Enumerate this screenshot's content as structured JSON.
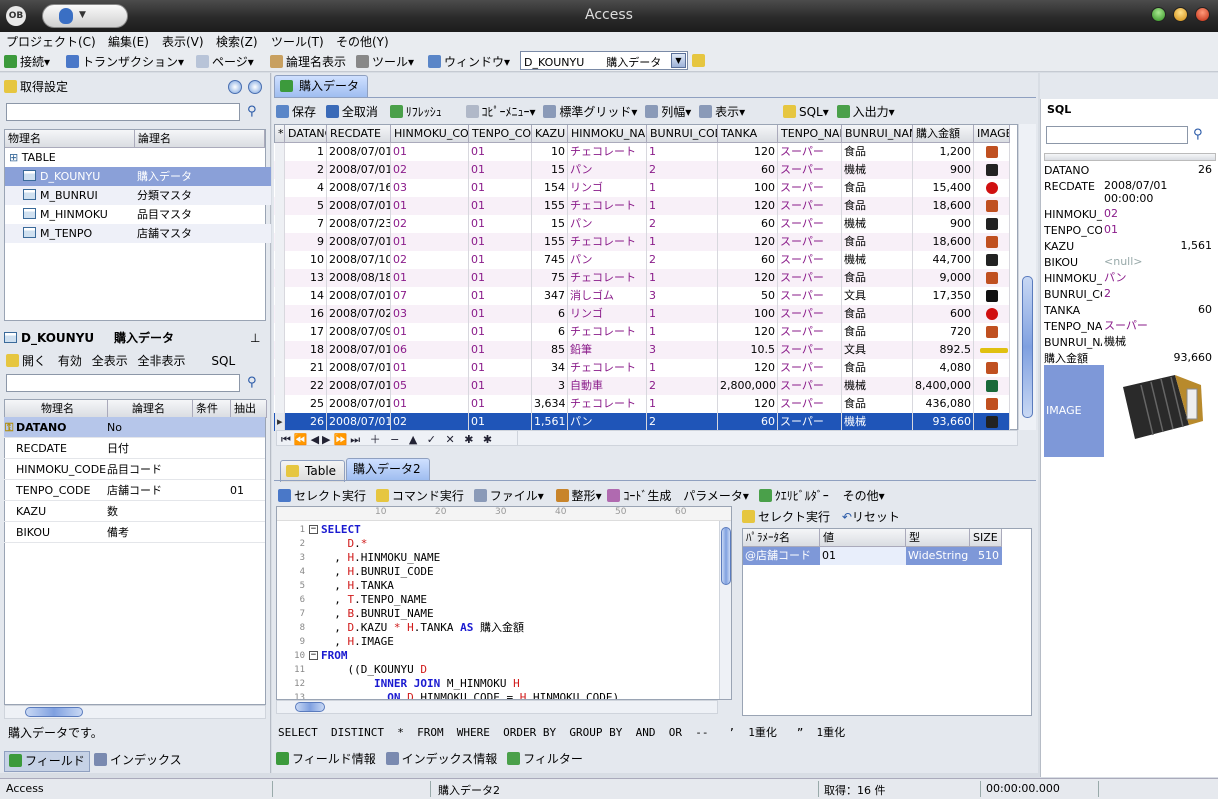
{
  "window": {
    "title": "Access",
    "logo_text": "OB"
  },
  "menu": [
    "プロジェクト(C)",
    "編集(E)",
    "表示(V)",
    "検索(Z)",
    "ツール(T)",
    "その他(Y)"
  ],
  "toolbar": {
    "connect": "接続",
    "transaction": "トランザクション",
    "page": "ページ",
    "logical_name": "論理名表示",
    "tool": "ツール",
    "window": "ウィンドウ",
    "combo_value": "D_KOUNYU　　購入データ"
  },
  "left": {
    "acquire_settings": "取得設定",
    "tree_headers": [
      "物理名",
      "論理名"
    ],
    "tree_root": "TABLE",
    "tree_items": [
      {
        "phys": "D_KOUNYU",
        "logi": "購入データ"
      },
      {
        "phys": "M_BUNRUI",
        "logi": "分類マスタ"
      },
      {
        "phys": "M_HINMOKU",
        "logi": "品目マスタ"
      },
      {
        "phys": "M_TENPO",
        "logi": "店舗マスタ"
      }
    ],
    "table_title_phys": "D_KOUNYU",
    "table_title_logi": "購入データ",
    "pin": "ꟸ",
    "actions": [
      "開く",
      "有効",
      "全表示",
      "全非表示",
      "SQL"
    ],
    "field_headers": [
      "物理名",
      "論理名",
      "条件",
      "抽出"
    ],
    "fields": [
      {
        "phys": "DATANO",
        "logi": "No",
        "cond": "",
        "ext": ""
      },
      {
        "phys": "RECDATE",
        "logi": "日付",
        "cond": "",
        "ext": ""
      },
      {
        "phys": "HINMOKU_CODE",
        "logi": "品目コード",
        "cond": "",
        "ext": ""
      },
      {
        "phys": "TENPO_CODE",
        "logi": "店舗コード",
        "cond": "01",
        "ext": ""
      },
      {
        "phys": "KAZU",
        "logi": "数",
        "cond": "",
        "ext": ""
      },
      {
        "phys": "BIKOU",
        "logi": "備考",
        "cond": "",
        "ext": ""
      }
    ],
    "description": "購入データです。",
    "bottom_tabs": [
      "フィールド",
      "インデックス"
    ]
  },
  "center": {
    "tab": "購入データ",
    "toolbar": [
      "保存",
      "全取消",
      "ﾘﾌﾚｯｼｭ",
      "ｺﾋﾟｰﾒﾆｭｰ",
      "標準グリッド",
      "列幅",
      "表示",
      "SQL",
      "入出力"
    ],
    "columns": [
      "DATANO",
      "RECDATE",
      "HINMOKU_CODE",
      "TENPO_CODE",
      "KAZU",
      "HINMOKU_NAME",
      "BUNRUI_CODE",
      "TANKA",
      "TENPO_NAME",
      "BUNRUI_NAME",
      "購入金額",
      "IMAGE"
    ],
    "rows": [
      [
        "1",
        "2008/07/01",
        "01",
        "01",
        "10",
        "チェコレート",
        "1",
        "120",
        "スーパー",
        "食品",
        "1,200",
        "pencil"
      ],
      [
        "2",
        "2008/07/01",
        "02",
        "01",
        "15",
        "パン",
        "2",
        "60",
        "スーパー",
        "機械",
        "900",
        "accordion"
      ],
      [
        "4",
        "2008/07/16",
        "03",
        "01",
        "154",
        "リンゴ",
        "1",
        "100",
        "スーパー",
        "食品",
        "15,400",
        "apple"
      ],
      [
        "5",
        "2008/07/01",
        "01",
        "01",
        "155",
        "チェコレート",
        "1",
        "120",
        "スーパー",
        "食品",
        "18,600",
        "pencil"
      ],
      [
        "7",
        "2008/07/23",
        "02",
        "01",
        "15",
        "パン",
        "2",
        "60",
        "スーパー",
        "機械",
        "900",
        "accordion"
      ],
      [
        "9",
        "2008/07/01",
        "01",
        "01",
        "155",
        "チェコレート",
        "1",
        "120",
        "スーパー",
        "食品",
        "18,600",
        "pencil"
      ],
      [
        "10",
        "2008/07/10",
        "02",
        "01",
        "745",
        "パン",
        "2",
        "60",
        "スーパー",
        "機械",
        "44,700",
        "accordion"
      ],
      [
        "13",
        "2008/08/18",
        "01",
        "01",
        "75",
        "チェコレート",
        "1",
        "120",
        "スーパー",
        "食品",
        "9,000",
        "pencil"
      ],
      [
        "14",
        "2008/07/01",
        "07",
        "01",
        "347",
        "消しゴム",
        "3",
        "50",
        "スーパー",
        "文具",
        "17,350",
        "eraser"
      ],
      [
        "16",
        "2008/07/02",
        "03",
        "01",
        "6",
        "リンゴ",
        "1",
        "100",
        "スーパー",
        "食品",
        "600",
        "apple"
      ],
      [
        "17",
        "2008/07/09",
        "01",
        "01",
        "6",
        "チェコレート",
        "1",
        "120",
        "スーパー",
        "食品",
        "720",
        "pencil"
      ],
      [
        "18",
        "2008/07/01",
        "06",
        "01",
        "85",
        "鉛筆",
        "3",
        "10.5",
        "スーパー",
        "文具",
        "892.5",
        "pencil2"
      ],
      [
        "21",
        "2008/07/01",
        "01",
        "01",
        "34",
        "チェコレート",
        "1",
        "120",
        "スーパー",
        "食品",
        "4,080",
        "pencil"
      ],
      [
        "22",
        "2008/07/01",
        "05",
        "01",
        "3",
        "自動車",
        "2",
        "2,800,000",
        "スーパー",
        "機械",
        "8,400,000",
        "car"
      ],
      [
        "25",
        "2008/07/01",
        "01",
        "01",
        "3,634",
        "チェコレート",
        "1",
        "120",
        "スーパー",
        "食品",
        "436,080",
        "pencil"
      ],
      [
        "26",
        "2008/07/01",
        "02",
        "01",
        "1,561",
        "パン",
        "2",
        "60",
        "スーパー",
        "機械",
        "93,660",
        "accordion"
      ]
    ],
    "bottom_tabs": [
      "Table",
      "購入データ2"
    ],
    "query_toolbar": [
      "セレクト実行",
      "コマンド実行",
      "ファイル",
      "整形",
      "ｺｰﾄﾞ生成",
      "パラメータ",
      "ｸｴﾘﾋﾞﾙﾀﾞｰ",
      "その他"
    ],
    "ruler": [
      "10",
      "20",
      "30",
      "40",
      "50",
      "60"
    ],
    "code_lines": [
      {
        "n": "1",
        "t": "SELECT"
      },
      {
        "n": "2",
        "t": "    D.*"
      },
      {
        "n": "3",
        "t": "  , H.HINMOKU_NAME"
      },
      {
        "n": "4",
        "t": "  , H.BUNRUI_CODE"
      },
      {
        "n": "5",
        "t": "  , H.TANKA"
      },
      {
        "n": "6",
        "t": "  , T.TENPO_NAME"
      },
      {
        "n": "7",
        "t": "  , B.BUNRUI_NAME"
      },
      {
        "n": "8",
        "t": "  , D.KAZU * H.TANKA AS 購入金額"
      },
      {
        "n": "9",
        "t": "  , H.IMAGE"
      },
      {
        "n": "10",
        "t": "FROM"
      },
      {
        "n": "11",
        "t": "    ((D_KOUNYU D"
      },
      {
        "n": "12",
        "t": "        INNER JOIN M_HINMOKU H"
      },
      {
        "n": "13",
        "t": "          ON D.HINMOKU_CODE = H.HINMOKU_CODE)"
      }
    ],
    "param_toolbar": [
      "セレクト実行",
      "リセット"
    ],
    "param_headers": [
      "ﾊﾟﾗﾒｰﾀ名",
      "値",
      "型",
      "SIZE"
    ],
    "params": [
      {
        "name": "@店舗コード",
        "value": "01",
        "type": "WideString",
        "size": "510"
      }
    ],
    "keywords_bar": "SELECT  DISTINCT  *  FROM  WHERE  ORDER BY  GROUP BY  AND  OR  --   ’  1重化   ”  1重化",
    "info_tabs": [
      "フィールド情報",
      "インデックス情報",
      "フィルター"
    ]
  },
  "right": {
    "title": "SQL",
    "fields": [
      {
        "k": "DATANO",
        "v": "26"
      },
      {
        "k": "RECDATE",
        "v": "2008/07/01 00:00:00"
      },
      {
        "k": "HINMOKU_CO",
        "v": "02"
      },
      {
        "k": "TENPO_CODE",
        "v": "01"
      },
      {
        "k": "KAZU",
        "v": "1,561"
      },
      {
        "k": "BIKOU",
        "v": "<null>"
      },
      {
        "k": "HINMOKU_NA",
        "v": "パン"
      },
      {
        "k": "BUNRUI_COD",
        "v": "2"
      },
      {
        "k": "TANKA",
        "v": "60"
      },
      {
        "k": "TENPO_NAME",
        "v": "スーパー"
      },
      {
        "k": "BUNRUI_NAM",
        "v": "機械"
      },
      {
        "k": "購入金額",
        "v": "93,660"
      }
    ],
    "image_label": "IMAGE"
  },
  "status": {
    "left": "Access",
    "table": "購入データ2",
    "count": "取得：16 件",
    "time": "00:00:00.000"
  },
  "colors": {
    "accent": "#1f55b8",
    "pk_text": "#8a1b8a",
    "keyword": "#1a1ad0",
    "alias": "#d01a1a"
  }
}
